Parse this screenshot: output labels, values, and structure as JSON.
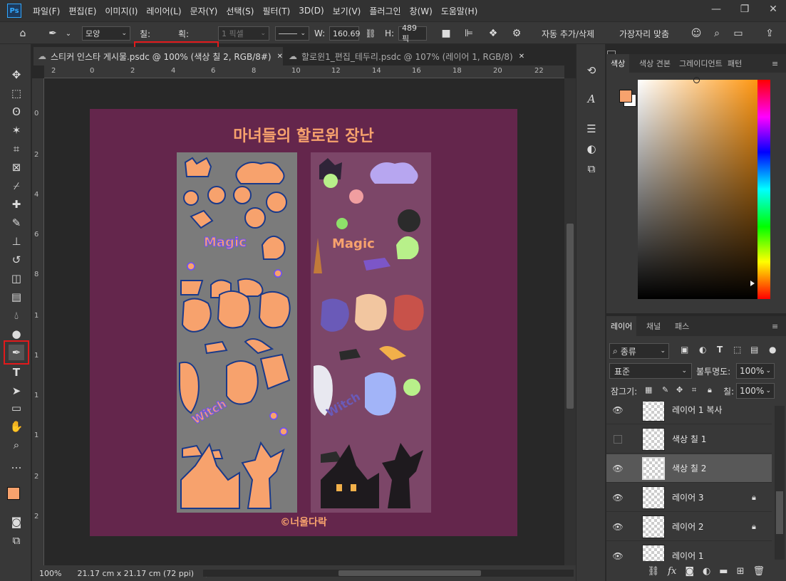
{
  "app": {
    "logo": "Ps"
  },
  "menu": [
    "파일(F)",
    "편집(E)",
    "이미지(I)",
    "레이어(L)",
    "문자(Y)",
    "선택(S)",
    "필터(T)",
    "3D(D)",
    "보기(V)",
    "플러그인",
    "창(W)",
    "도움말(H)"
  ],
  "window_controls": {
    "minimize": "—",
    "restore": "❐",
    "close": "✕"
  },
  "options": {
    "mode": "모양",
    "fill_label": "칠:",
    "fill_color": "#f7a26d",
    "stroke_label": "획:",
    "stroke_width": "1 픽셀",
    "w_label": "W:",
    "w_value": "160.69",
    "h_label": "H:",
    "h_value": "489 픽",
    "auto_add_delete": "자동 추가/삭제",
    "align_edges": "가장자리 맞춤"
  },
  "tabs": [
    {
      "label": "스티커 인스타 게시물.psdc @ 100% (색상 칠 2, RGB/8#)",
      "close": "✕",
      "active": true
    },
    {
      "label": "할로윈1_편집_테두리.psdc @ 107% (레이어 1, RGB/8)",
      "close": "✕",
      "active": false
    }
  ],
  "ruler_top": [
    "2",
    "0",
    "2",
    "4",
    "6",
    "8",
    "10",
    "12",
    "14",
    "16",
    "18",
    "20",
    "22"
  ],
  "ruler_left": [
    "0",
    "2",
    "4",
    "6",
    "8",
    "1",
    "1",
    "1",
    "1",
    "2",
    "2"
  ],
  "artwork": {
    "title": "마녀들의 할로윈 장난",
    "credit": "©너울다락",
    "left_word": "Magic",
    "left_word2": "Witch",
    "right_word": "Magic",
    "right_word2": "Witch",
    "bg_color": "#64264c",
    "accent_color": "#f7a26d"
  },
  "status": {
    "zoom": "100%",
    "doc_size": "21.17 cm x 21.17 cm (72 ppi)",
    "arrow": "〉"
  },
  "color_panel": {
    "tabs": [
      "색상",
      "색상 견본",
      "그레이디언트",
      "패턴"
    ],
    "foreground": "#f7a26d",
    "background": "#ffffff"
  },
  "layers_panel": {
    "tabs": [
      "레이어",
      "채널",
      "패스"
    ],
    "filter_kind": "종류",
    "blend_mode": "표준",
    "opacity_label": "불투명도:",
    "opacity_value": "100%",
    "lock_label": "잠그기:",
    "fill_label": "칠:",
    "fill_value": "100%",
    "layers": [
      {
        "name": "레이어 1 복사",
        "visible": true,
        "locked": false,
        "selected": false
      },
      {
        "name": "색상 칠 1",
        "visible": false,
        "locked": false,
        "selected": false
      },
      {
        "name": "색상 칠 2",
        "visible": true,
        "locked": false,
        "selected": true
      },
      {
        "name": "레이어 3",
        "visible": true,
        "locked": true,
        "selected": false
      },
      {
        "name": "레이어 2",
        "visible": true,
        "locked": true,
        "selected": false
      },
      {
        "name": "레이어 1",
        "visible": true,
        "locked": false,
        "selected": false
      }
    ],
    "footer_icons": [
      "link-icon",
      "fx-icon",
      "mask-icon",
      "adjustment-icon",
      "group-icon",
      "new-layer-icon",
      "delete-icon"
    ]
  }
}
